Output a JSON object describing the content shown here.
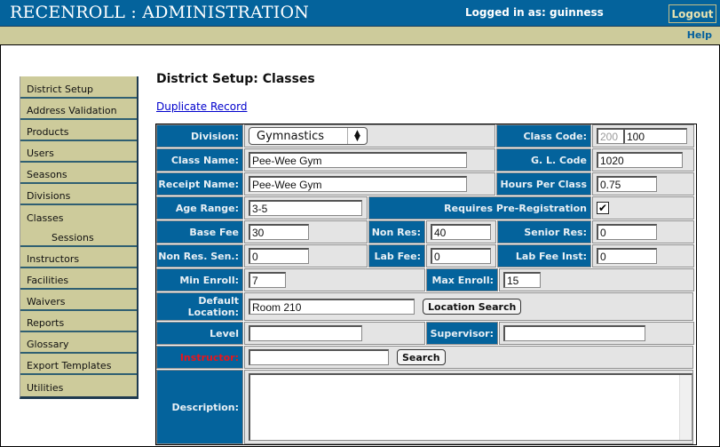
{
  "header": {
    "app_title": "RECENROLL : ADMINISTRATION",
    "logged_in_text": "Logged in as: guinness",
    "logout_label": "Logout",
    "help_label": "Help"
  },
  "sidebar": {
    "items": [
      {
        "label": "District Setup"
      },
      {
        "label": "Address Validation"
      },
      {
        "label": "Products"
      },
      {
        "label": "Users"
      },
      {
        "label": "Seasons"
      },
      {
        "label": "Divisions"
      },
      {
        "label": "Classes"
      },
      {
        "label": "Sessions"
      },
      {
        "label": "Instructors"
      },
      {
        "label": "Facilities"
      },
      {
        "label": "Waivers"
      },
      {
        "label": "Reports"
      },
      {
        "label": "Glossary"
      },
      {
        "label": "Export Templates"
      },
      {
        "label": "Utilities"
      }
    ]
  },
  "main": {
    "page_title": "District Setup: Classes",
    "duplicate_link": "Duplicate Record"
  },
  "form": {
    "division": {
      "label": "Division:",
      "value": "Gymnastics"
    },
    "class_code": {
      "label": "Class Code:",
      "prefix": "200",
      "value": "100"
    },
    "class_name": {
      "label": "Class Name:",
      "value": "Pee-Wee Gym"
    },
    "gl_code": {
      "label": "G. L. Code",
      "value": "1020"
    },
    "receipt_name": {
      "label": "Receipt Name:",
      "value": "Pee-Wee Gym"
    },
    "hours_per_class": {
      "label": "Hours Per Class",
      "value": "0.75"
    },
    "age_range": {
      "label": "Age Range:",
      "value": "3-5"
    },
    "requires_prereg": {
      "label": "Requires Pre-Registration",
      "checked": true,
      "mark": "✔"
    },
    "base_fee": {
      "label": "Base Fee",
      "value": "30"
    },
    "non_res": {
      "label": "Non Res:",
      "value": "40"
    },
    "senior_res": {
      "label": "Senior Res:",
      "value": "0"
    },
    "non_res_sen": {
      "label": "Non Res. Sen.:",
      "value": "0"
    },
    "lab_fee": {
      "label": "Lab Fee:",
      "value": "0"
    },
    "lab_fee_inst": {
      "label": "Lab Fee Inst:",
      "value": "0"
    },
    "min_enroll": {
      "label": "Min Enroll:",
      "value": "7"
    },
    "max_enroll": {
      "label": "Max Enroll:",
      "value": "15"
    },
    "default_location": {
      "label_line1": "Default",
      "label_line2": "Location:",
      "value": "Room 210",
      "button": "Location Search"
    },
    "level": {
      "label": "Level",
      "value": ""
    },
    "supervisor": {
      "label": "Supervisor:",
      "value": ""
    },
    "instructor": {
      "label": "Instructor:",
      "value": "",
      "button": "Search",
      "label_color": "#e8141b"
    },
    "description": {
      "label": "Description:",
      "value": ""
    }
  },
  "colors": {
    "header_blue": "#04639c",
    "sidebar_khaki": "#cdcb9b",
    "label_blue": "#04639c",
    "value_grey": "#e4e4e4",
    "required_red": "#e8141b"
  }
}
